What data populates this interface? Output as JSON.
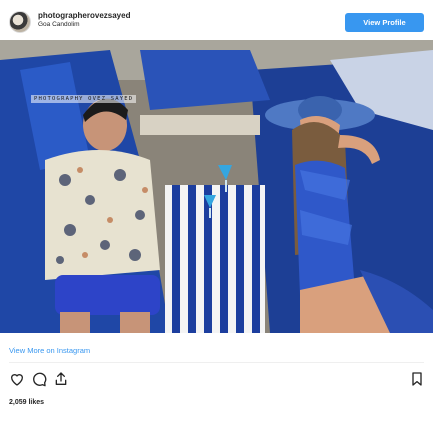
{
  "header": {
    "username": "photographerovezsayed",
    "location": "Goa Candolim",
    "view_profile_label": "View Profile"
  },
  "photo": {
    "watermark": "PHOTOGRAPHY OVEZ SAYED",
    "description_icon": "beach-photo-image"
  },
  "footer": {
    "view_more_label": "View More on Instagram",
    "likes": "2,059 likes"
  },
  "icons": {
    "like": "heart-icon",
    "comment": "comment-icon",
    "share": "share-icon",
    "save": "bookmark-icon"
  },
  "colors": {
    "accent": "#3897f0",
    "text": "#262626"
  }
}
